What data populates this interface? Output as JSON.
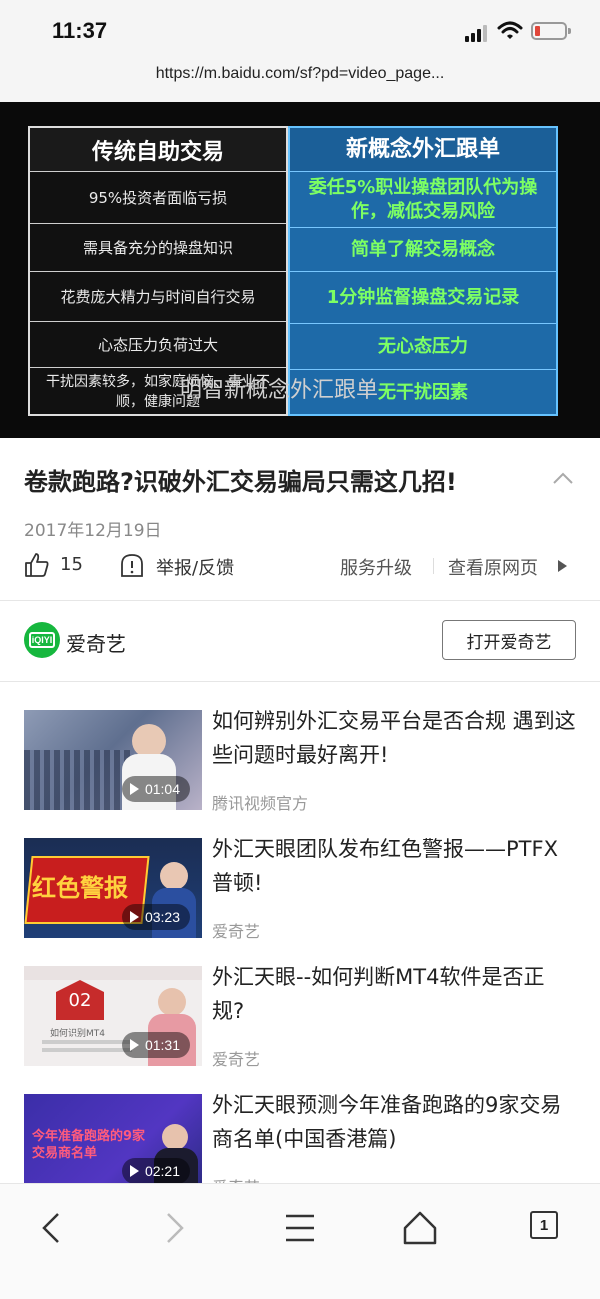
{
  "status_bar": {
    "time": "11:37"
  },
  "browser": {
    "url": "https://m.baidu.com/sf?pd=video_page..."
  },
  "video": {
    "table": {
      "left_header": "传统自助交易",
      "right_header": "新概念外汇跟单",
      "left_rows": [
        "95%投资者面临亏损",
        "需具备充分的操盘知识",
        "花费庞大精力与时间自行交易",
        "心态压力负荷过大",
        "干扰因素较多，如家庭烦恼、事业不顺，健康问题"
      ],
      "right_rows": [
        "委任5%职业操盘团队代为操作，减低交易风险",
        "简单了解交易概念",
        "1分钟监督操盘交易记录",
        "无心态压力",
        "无干扰因素"
      ]
    },
    "caption": "明智新概念外汇跟单"
  },
  "article": {
    "title": "卷款跑路?识破外汇交易骗局只需这几招!",
    "date": "2017年12月19日",
    "likes": "15",
    "report_label": "举报/反馈",
    "service_upgrade_label": "服务升级",
    "view_original_label": "查看原网页"
  },
  "source": {
    "logo_text": "iQIYI",
    "name": "爱奇艺",
    "open_button_label": "打开爱奇艺"
  },
  "related": [
    {
      "title": "如何辨别外汇交易平台是否合规 遇到这些问题时最好离开!",
      "source": "腾讯视频官方",
      "duration": "01:04"
    },
    {
      "title": "外汇天眼团队发布红色警报——PTFX普顿!",
      "source": "爱奇艺",
      "duration": "03:23",
      "thumb_text": "红色警报"
    },
    {
      "title": "外汇天眼--如何判断MT4软件是否正规?",
      "source": "爱奇艺",
      "duration": "01:31",
      "thumb_badge": "02",
      "thumb_text": "如何识别MT4"
    },
    {
      "title": "外汇天眼预测今年准备跑路的9家交易商名单(中国香港篇)",
      "source": "爱奇艺",
      "duration": "02:21",
      "thumb_text": "今年准备跑路的9家交易商名单"
    }
  ],
  "bottom_bar": {
    "tab_count": "1"
  },
  "colors": {
    "accent_green": "#16b73e",
    "video_green_text": "#7dff63",
    "video_blue": "#1e6aa8"
  }
}
